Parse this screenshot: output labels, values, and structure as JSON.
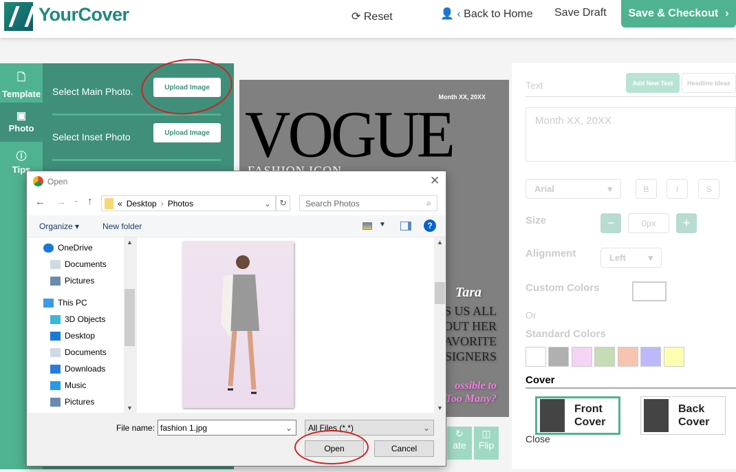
{
  "header": {
    "logo": "YourCover",
    "reset": "Reset",
    "back_home": "Back to Home",
    "save_draft": "Save Draft",
    "checkout": "Save & Checkout"
  },
  "sidebar": {
    "items": [
      {
        "label": "Template",
        "icon": "template-search-icon"
      },
      {
        "label": "Photo",
        "icon": "photo-icon"
      },
      {
        "label": "Tips",
        "icon": "help-circle-icon"
      }
    ]
  },
  "photo_panel": {
    "main_label": "Select Main Photo.",
    "inset_label": "Select Inset Photo",
    "upload": "Upload Image"
  },
  "cover": {
    "date": "Month XX, 20XX",
    "title": "VOGUE",
    "subtitle": "FASHION ICON",
    "name": "Tara",
    "lines": [
      "LLS US ALL",
      "OUT HER",
      "AVORITE",
      "SIGNERS"
    ],
    "pink": [
      "ossible to",
      "Too Many?"
    ]
  },
  "tools": {
    "rotate": "ate",
    "flip": "Flip"
  },
  "right_panel": {
    "text_label": "Text",
    "add_text": "Add New Text",
    "headline": "Headline Ideas",
    "textarea_placeholder": "Month XX, 20XX",
    "font": "Arial",
    "bold": "B",
    "italic": "I",
    "strike": "S",
    "size_label": "Size",
    "minus": "−",
    "size_value": "0px",
    "plus": "+",
    "alignment_label": "Alignment",
    "alignment_value": "Left",
    "custom_colors": "Custom Colors",
    "or": "Or",
    "standard_colors": "Standard Colors",
    "swatches": [
      "#ffffff",
      "#b0b0b0",
      "#f4d4f4",
      "#c5dcb5",
      "#f7c4b0",
      "#bdb8fb",
      "#fdffb0"
    ],
    "cover_label": "Cover",
    "front": [
      "Front",
      "Cover"
    ],
    "back": [
      "Back",
      "Cover"
    ],
    "close": "Close",
    "accent": "#4fb391"
  },
  "dialog": {
    "title": "Open",
    "path": [
      "Desktop",
      "Photos"
    ],
    "search_placeholder": "Search Photos",
    "organize": "Organize",
    "new_folder": "New folder",
    "nav": [
      {
        "label": "OneDrive",
        "icon": "cloud-icon",
        "indent": 0
      },
      {
        "label": "Documents",
        "icon": "document-icon",
        "indent": 1
      },
      {
        "label": "Pictures",
        "icon": "pictures-icon",
        "indent": 1
      },
      {
        "label": "This PC",
        "icon": "computer-icon",
        "indent": 0
      },
      {
        "label": "3D Objects",
        "icon": "cube-icon",
        "indent": 1
      },
      {
        "label": "Desktop",
        "icon": "desktop-icon",
        "indent": 1
      },
      {
        "label": "Documents",
        "icon": "document-icon",
        "indent": 1
      },
      {
        "label": "Downloads",
        "icon": "download-icon",
        "indent": 1
      },
      {
        "label": "Music",
        "icon": "music-icon",
        "indent": 1
      },
      {
        "label": "Pictures",
        "icon": "pictures-icon",
        "indent": 1
      }
    ],
    "filename_label": "File name:",
    "filename": "fashion 1.jpg",
    "filetype": "All Files (*.*)",
    "open": "Open",
    "cancel": "Cancel"
  }
}
